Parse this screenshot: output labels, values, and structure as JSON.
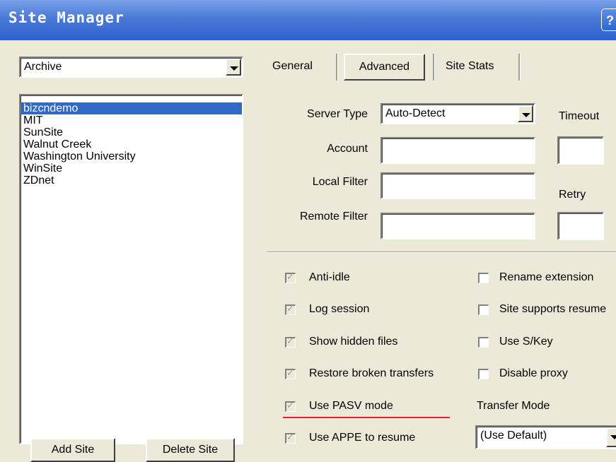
{
  "window": {
    "title": "Site Manager",
    "help_glyph": "?"
  },
  "category": {
    "selected": "Archive"
  },
  "sites": [
    "bizcndemo",
    "MIT",
    "SunSite",
    "Walnut Creek",
    "Washington University",
    "WinSite",
    "ZDnet"
  ],
  "selected_site": "bizcndemo",
  "buttons": {
    "add_site": "Add Site",
    "delete_site": "Delete Site"
  },
  "tabs": [
    {
      "label": "General"
    },
    {
      "label": "Advanced",
      "active": true
    },
    {
      "label": "Site Stats"
    }
  ],
  "advanced": {
    "server_type_label": "Server Type",
    "server_type_value": "Auto-Detect",
    "timeout_label": "Timeout",
    "account_label": "Account",
    "local_filter_label": "Local Filter",
    "retry_label": "Retry",
    "remote_filter_label": "Remote Filter",
    "account_value": "",
    "local_filter_value": "",
    "remote_filter_value": "",
    "timeout_value": "",
    "retry_value": ""
  },
  "options_left": [
    {
      "label": "Anti-idle",
      "checked": true,
      "disabled": true
    },
    {
      "label": "Log session",
      "checked": true,
      "disabled": true
    },
    {
      "label": "Show hidden files",
      "checked": true,
      "disabled": true
    },
    {
      "label": "Restore broken transfers",
      "checked": true,
      "disabled": true
    },
    {
      "label": "Use PASV mode",
      "checked": true,
      "disabled": true
    },
    {
      "label": "Use APPE to resume",
      "checked": true,
      "disabled": true
    }
  ],
  "options_right": [
    {
      "label": "Rename extension",
      "checked": false
    },
    {
      "label": "Site supports resume",
      "checked": false
    },
    {
      "label": "Use S/Key",
      "checked": false
    },
    {
      "label": "Disable proxy",
      "checked": false
    }
  ],
  "transfer_mode": {
    "label": "Transfer Mode",
    "value": "(Use Default)"
  },
  "colors": {
    "titlebar": "#2f62cf",
    "selection": "#316ac5",
    "highlight_underline": "#e0202a",
    "dialog_bg": "#ece9d8"
  },
  "icons": {
    "checkmark": "✓"
  }
}
